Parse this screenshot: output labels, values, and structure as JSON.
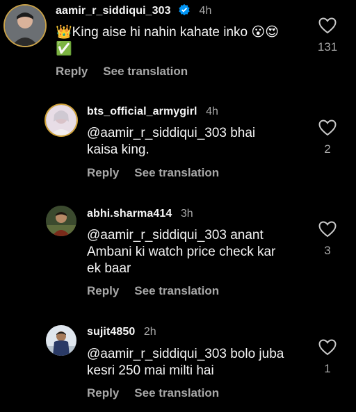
{
  "comments": [
    {
      "username": "aamir_r_siddiqui_303",
      "verified": true,
      "time": "4h",
      "text_line1": "👑King aise hi nahin kahate inko 😮😍",
      "text_line2": "✅",
      "likes": "131",
      "reply_label": "Reply",
      "translate_label": "See translation"
    },
    {
      "username": "bts_official_armygirl",
      "time": "4h",
      "text_line1": "@aamir_r_siddiqui_303 bhai",
      "text_line2": "kaisa king.",
      "likes": "2",
      "reply_label": "Reply",
      "translate_label": "See translation"
    },
    {
      "username": "abhi.sharma414",
      "time": "3h",
      "text_line1": "@aamir_r_siddiqui_303 anant",
      "text_line2": "Ambani ki watch price check kar",
      "text_line3": "ek baar",
      "likes": "3",
      "reply_label": "Reply",
      "translate_label": "See translation"
    },
    {
      "username": "sujit4850",
      "time": "2h",
      "text_line1": "@aamir_r_siddiqui_303 bolo juba",
      "text_line2": "kesri 250 mai milti hai",
      "likes": "1",
      "reply_label": "Reply",
      "translate_label": "See translation"
    }
  ],
  "icons": {
    "like": "heart-outline-icon",
    "verified": "verified-badge-icon"
  },
  "colors": {
    "background": "#000000",
    "text": "#f5f5f5",
    "secondary": "#a8a8a8",
    "verified": "#0095f6"
  }
}
